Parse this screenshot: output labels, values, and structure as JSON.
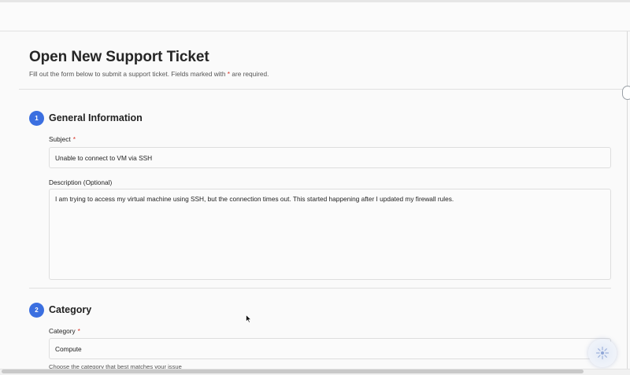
{
  "page": {
    "title": "Open New Support Ticket",
    "subtitle_before": "Fill out the form below to submit a support ticket. Fields marked with",
    "subtitle_star": "*",
    "subtitle_after": "are required."
  },
  "sections": [
    {
      "step": "1",
      "title": "General Information",
      "subject_label": "Subject",
      "subject_required": "*",
      "subject_value": "Unable to connect to VM via SSH",
      "description_label": "Description (Optional)",
      "description_value": "I am trying to access my virtual machine using SSH, but the connection times out. This started happening after I updated my firewall rules."
    },
    {
      "step": "2",
      "title": "Category",
      "category_label": "Category",
      "category_required": "*",
      "category_value": "Compute",
      "category_helper": "Choose the category that best matches your issue"
    }
  ],
  "colors": {
    "accent": "#3b6fe0",
    "required": "#d93025"
  },
  "icons": {
    "cursor": "mouse-pointer-icon",
    "chat": "assistant-sparkle-icon"
  }
}
